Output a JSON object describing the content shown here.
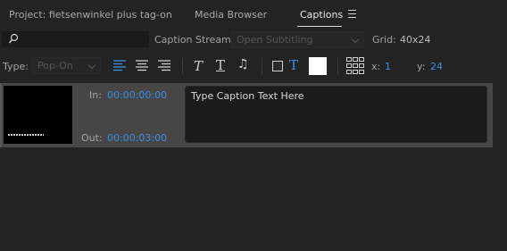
{
  "tabs": [
    {
      "label": "Project: fietsenwinkel plus tag-on",
      "active": false
    },
    {
      "label": "Media Browser",
      "active": false
    },
    {
      "label": "Captions",
      "active": true
    }
  ],
  "icons": {
    "panel_menu": "hamburger-menu-icon",
    "search": "search-icon",
    "align_left": "align-left-icon",
    "align_center": "align-center-icon",
    "align_right": "align-right-icon",
    "italic": "italic-icon",
    "underline": "underline-icon",
    "text_size": "text-size-icon",
    "music": "music-note-icon",
    "background": "background-color-icon",
    "text_color": "text-color-icon",
    "position_grid": "position-grid-icon"
  },
  "search": {
    "placeholder": "",
    "value": ""
  },
  "caption_stream": {
    "label": "Caption Stream:",
    "value": "Open Subtitling"
  },
  "grid": {
    "label": "Grid:",
    "value": "40x24"
  },
  "type": {
    "label": "Type:",
    "value": "Pop-On"
  },
  "position": {
    "x_label": "x:",
    "x_value": "1",
    "y_label": "y:",
    "y_value": "24"
  },
  "colors": {
    "accent": "#3d8ee0",
    "panel_bg": "#232323",
    "row_bg": "#464646",
    "swatch": "#ffffff"
  },
  "caption": {
    "in_label": "In:",
    "in_time": "00:00:00:00",
    "out_label": "Out:",
    "out_time": "00:00:03:00",
    "text": "Type Caption Text Here"
  }
}
